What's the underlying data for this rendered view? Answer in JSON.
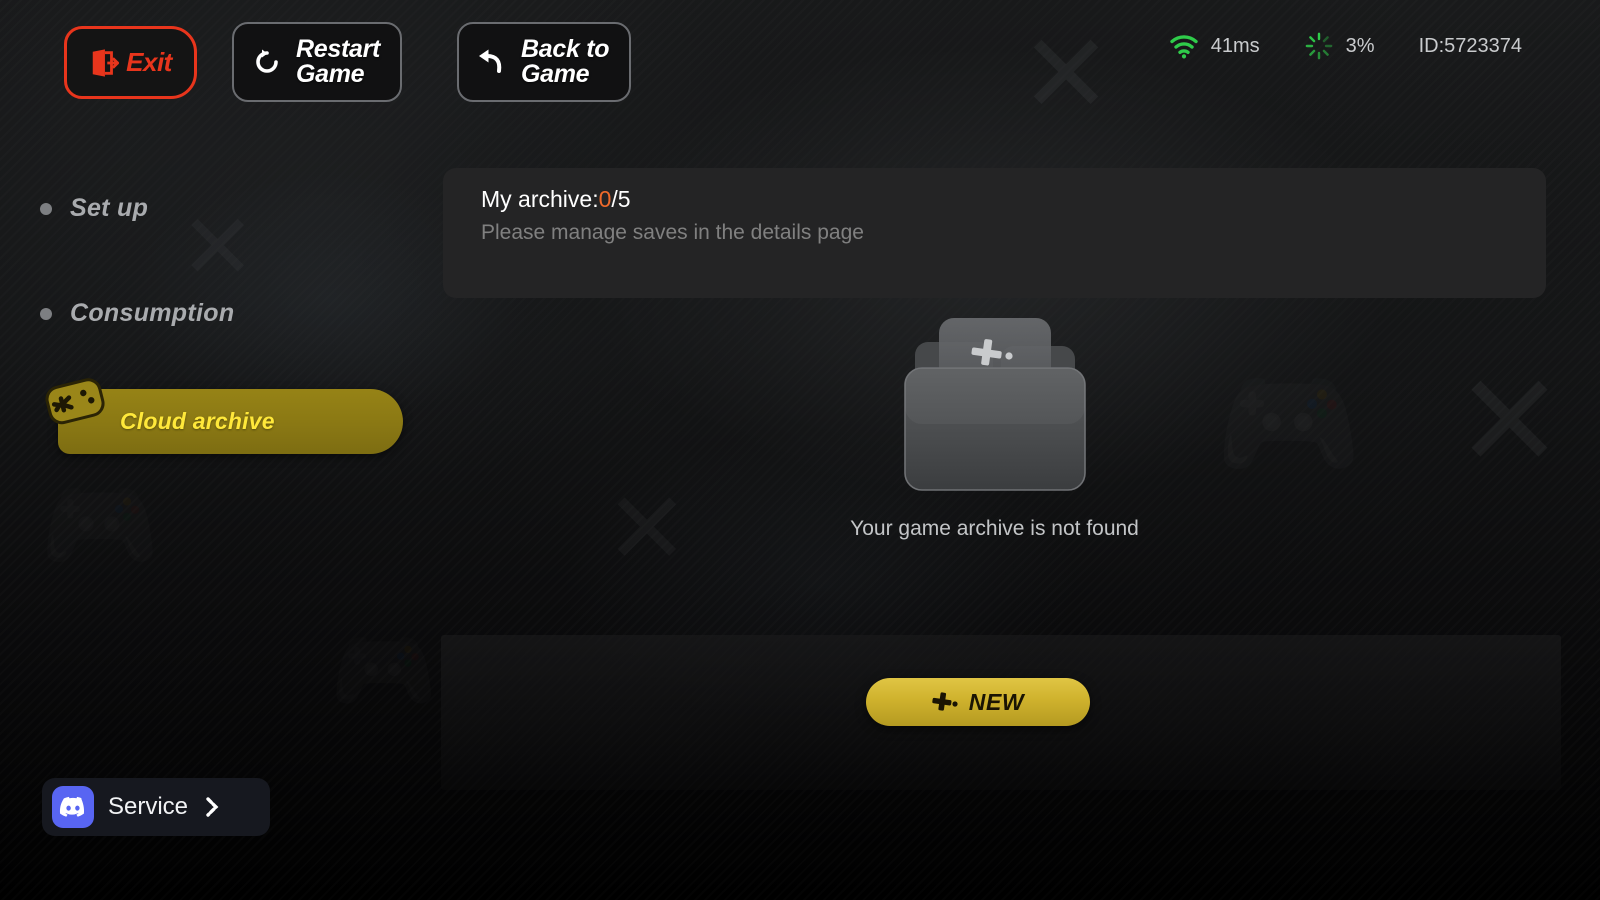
{
  "topbar": {
    "exit": {
      "label": "Exit",
      "icon": "door-exit-icon",
      "border_color": "#e8351c"
    },
    "restart": {
      "label_line1": "Restart",
      "label_line2": "Game",
      "icon": "refresh-icon"
    },
    "back": {
      "label_line1": "Back to",
      "label_line2": "Game",
      "icon": "back-arrow-icon"
    }
  },
  "status": {
    "wifi_icon": "wifi-icon",
    "latency": "41ms",
    "loading_icon": "spinner-icon",
    "load_percent": "3%",
    "device_id": "ID:5723374",
    "accent_color": "#2fcc4a"
  },
  "sidebar": {
    "items": [
      {
        "label": "Set up",
        "icon": "bullet-dot-icon",
        "active": false
      },
      {
        "label": "Consumption",
        "icon": "bullet-dot-icon",
        "active": false
      },
      {
        "label": "Cloud archive",
        "icon": "gamepad-icon",
        "active": true
      }
    ],
    "active_bg_color": "#8a7814",
    "active_text_color": "#ffe83a"
  },
  "service": {
    "label": "Service",
    "icon": "discord-icon",
    "chevron_icon": "chevron-right-icon",
    "brand_color": "#5865f2"
  },
  "main": {
    "archive": {
      "title_prefix": "My archive:",
      "used": "0",
      "separator_total": "/5",
      "used_color": "#ef6a2b",
      "subtitle": "Please manage saves in the details page"
    },
    "empty_state": {
      "icon": "empty-folder-icon",
      "message": "Your game archive is not found"
    },
    "new_button": {
      "label": "NEW",
      "icon": "plus-icon",
      "bg_color": "#cfb22d"
    }
  }
}
